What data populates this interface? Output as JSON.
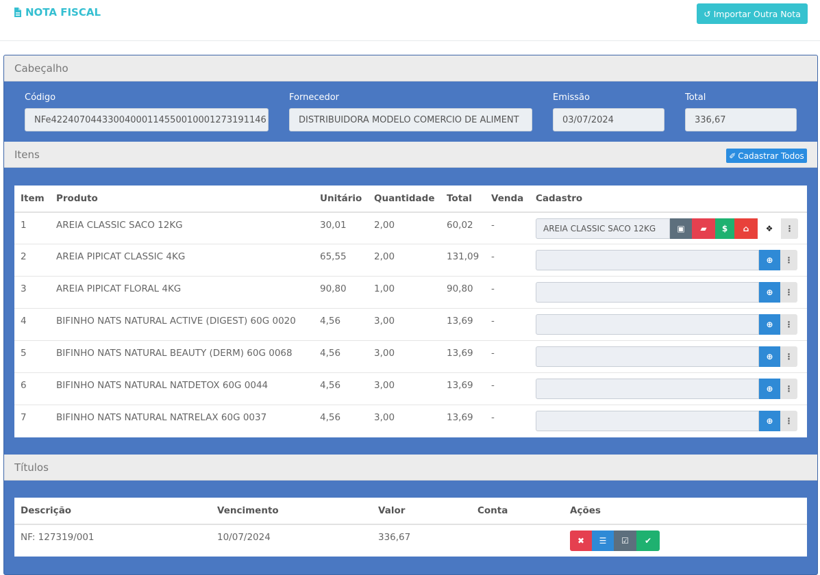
{
  "header": {
    "title": "NOTA FISCAL",
    "import_button": "Importar Outra Nota"
  },
  "cabecalho": {
    "title": "Cabeçalho",
    "codigo_label": "Código",
    "codigo_value": "NFe42240704433004000114550010001273191146",
    "fornecedor_label": "Fornecedor",
    "fornecedor_value": "DISTRIBUIDORA MODELO COMERCIO DE ALIMENT",
    "emissao_label": "Emissão",
    "emissao_value": "03/07/2024",
    "total_label": "Total",
    "total_value": "336,67"
  },
  "itens": {
    "title": "Itens",
    "cadastrar_todos": "Cadastrar Todos",
    "columns": [
      "Item",
      "Produto",
      "Unitário",
      "Quantidade",
      "Total",
      "Venda",
      "Cadastro"
    ],
    "rows": [
      {
        "item": "1",
        "produto": "AREIA CLASSIC SACO 12KG",
        "unitario": "30,01",
        "quantidade": "2,00",
        "total": "60,02",
        "venda": "-",
        "cadastro": "AREIA CLASSIC SACO 12KG"
      },
      {
        "item": "2",
        "produto": "AREIA PIPICAT CLASSIC 4KG",
        "unitario": "65,55",
        "quantidade": "2,00",
        "total": "131,09",
        "venda": "-",
        "cadastro": ""
      },
      {
        "item": "3",
        "produto": "AREIA PIPICAT FLORAL 4KG",
        "unitario": "90,80",
        "quantidade": "1,00",
        "total": "90,80",
        "venda": "-",
        "cadastro": ""
      },
      {
        "item": "4",
        "produto": "BIFINHO NATS NATURAL ACTIVE (DIGEST) 60G 0020",
        "unitario": "4,56",
        "quantidade": "3,00",
        "total": "13,69",
        "venda": "-",
        "cadastro": ""
      },
      {
        "item": "5",
        "produto": "BIFINHO NATS NATURAL BEAUTY (DERM) 60G 0068",
        "unitario": "4,56",
        "quantidade": "3,00",
        "total": "13,69",
        "venda": "-",
        "cadastro": ""
      },
      {
        "item": "6",
        "produto": "BIFINHO NATS NATURAL NATDETOX 60G 0044",
        "unitario": "4,56",
        "quantidade": "3,00",
        "total": "13,69",
        "venda": "-",
        "cadastro": ""
      },
      {
        "item": "7",
        "produto": "BIFINHO NATS NATURAL NATRELAX 60G 0037",
        "unitario": "4,56",
        "quantidade": "3,00",
        "total": "13,69",
        "venda": "-",
        "cadastro": ""
      }
    ]
  },
  "titulos": {
    "title": "Títulos",
    "columns": [
      "Descrição",
      "Vencimento",
      "Valor",
      "Conta",
      "Ações"
    ],
    "rows": [
      {
        "descricao": "NF: 127319/001",
        "vencimento": "10/07/2024",
        "valor": "336,67",
        "conta": ""
      }
    ]
  },
  "colors": {
    "accent": "#35bfd1",
    "panel_blue": "#4a78c2",
    "primary": "#2f8ad6",
    "danger": "#e5404f",
    "success": "#1fb170"
  }
}
